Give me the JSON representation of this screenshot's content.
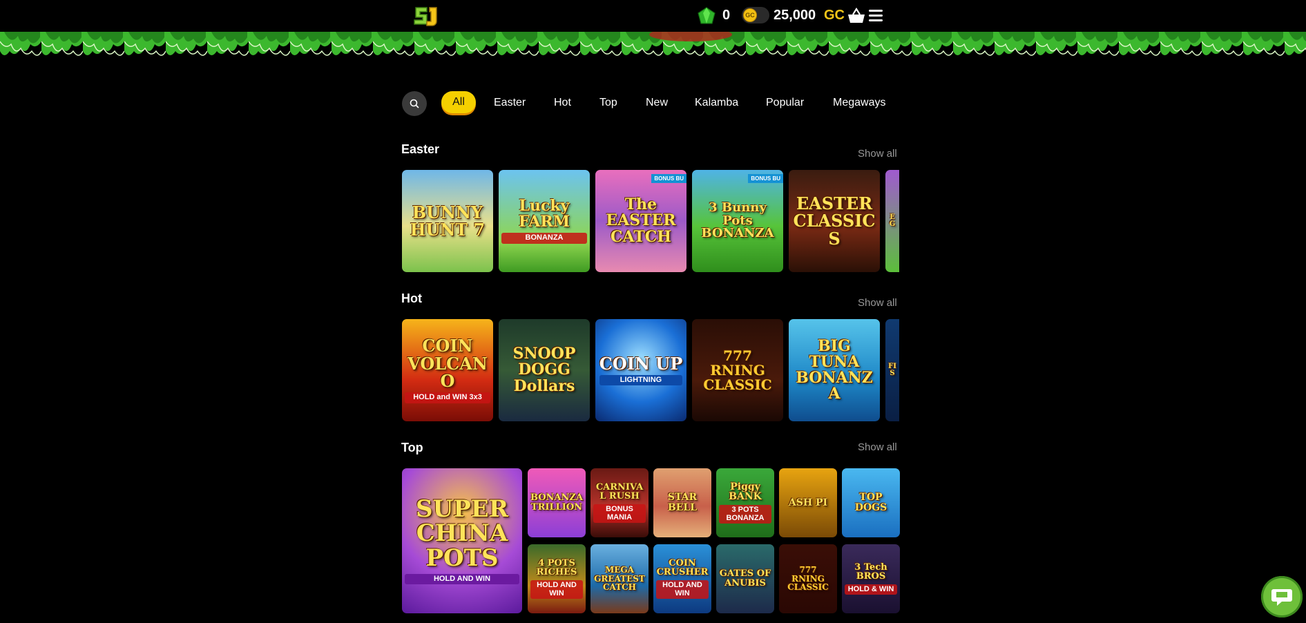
{
  "header": {
    "logo_alt": "SJ",
    "sweeps_balance": "0",
    "coin_toggle_label": "GC",
    "gold_balance": "25,000",
    "gold_unit": "GC"
  },
  "colors": {
    "background": "#000000",
    "accent_yellow": "#f5d000",
    "jungle_green": "#3cb82e",
    "gold": "#f5c518"
  },
  "icons": [
    "logo",
    "gem-icon",
    "coin-toggle",
    "basket-icon",
    "menu-icon",
    "search-icon",
    "chat-icon"
  ],
  "tabs": [
    {
      "label": "All",
      "active": true
    },
    {
      "label": "Easter",
      "active": false
    },
    {
      "label": "Hot",
      "active": false
    },
    {
      "label": "Top",
      "active": false
    },
    {
      "label": "New",
      "active": false
    },
    {
      "label": "Kalamba",
      "active": false
    },
    {
      "label": "Popular",
      "active": false
    },
    {
      "label": "Megaways",
      "active": false
    }
  ],
  "sections": [
    {
      "title": "Easter",
      "show_all": "Show all",
      "games": [
        {
          "title": "BUNNY HUNT 7",
          "sub": ""
        },
        {
          "title": "Lucky FARM",
          "sub": "BONANZA"
        },
        {
          "title": "The EASTER CATCH",
          "sub": "",
          "badge": "BONUS BU"
        },
        {
          "title": "3 Bunny Pots BONANZA",
          "sub": "",
          "badge": "BONUS BU"
        },
        {
          "title": "EASTER CLASSICS",
          "sub": ""
        },
        {
          "title": "EG",
          "sub": ""
        }
      ]
    },
    {
      "title": "Hot",
      "show_all": "Show all",
      "games": [
        {
          "title": "COIN VOLCANO",
          "sub": "HOLD and WIN 3x3"
        },
        {
          "title": "SNOOP DOGG Dollars",
          "sub": ""
        },
        {
          "title": "COIN UP",
          "sub": "LIGHTNING"
        },
        {
          "title": "777 RNING CLASSIC",
          "sub": ""
        },
        {
          "title": "BIG TUNA BONANZA",
          "sub": ""
        },
        {
          "title": "FIS",
          "sub": ""
        }
      ]
    },
    {
      "title": "Top",
      "show_all": "Show all",
      "games": [
        {
          "title": "SUPER CHINA POTS",
          "sub": "HOLD AND WIN"
        },
        {
          "title": "BONANZA TRILLION",
          "sub": ""
        },
        {
          "title": "CARNIVAL RUSH",
          "sub": "BONUS MANIA"
        },
        {
          "title": "STAR BELL",
          "sub": ""
        },
        {
          "title": "Piggy BANK",
          "sub": "3 POTS BONANZA"
        },
        {
          "title": "ASH PI",
          "sub": ""
        },
        {
          "title": "TOP DOGS",
          "sub": ""
        },
        {
          "title": "4 POTS RICHES",
          "sub": "HOLD AND WIN"
        },
        {
          "title": "MEGA GREATEST CATCH",
          "sub": ""
        },
        {
          "title": "COIN CRUSHER",
          "sub": "HOLD AND WIN"
        },
        {
          "title": "GATES OF ANUBIS",
          "sub": ""
        },
        {
          "title": "777 RNING CLASSIC",
          "sub": ""
        },
        {
          "title": "3 Tech BROS",
          "sub": "HOLD & WIN"
        }
      ]
    }
  ]
}
